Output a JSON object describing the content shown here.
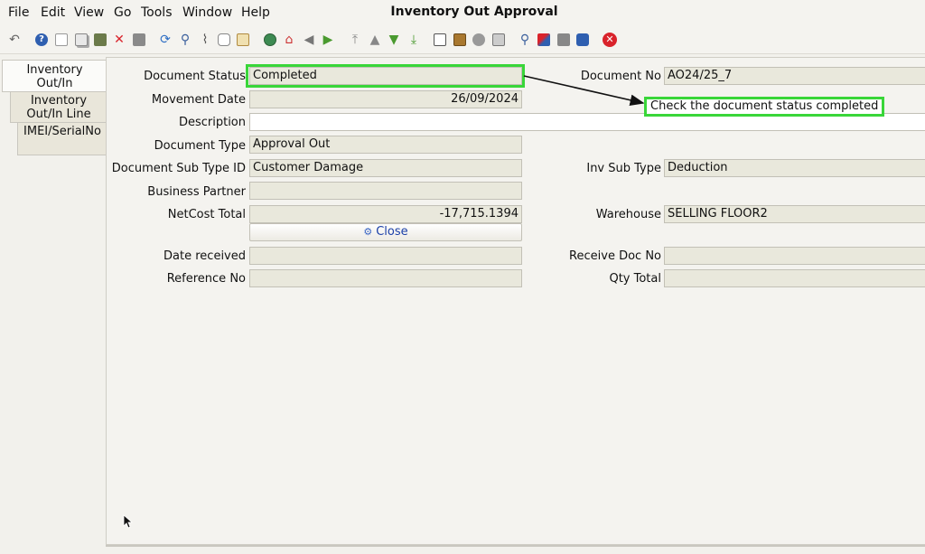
{
  "menu": {
    "items": [
      "File",
      "Edit",
      "View",
      "Go",
      "Tools",
      "Window",
      "Help"
    ]
  },
  "window": {
    "title": "Inventory Out Approval"
  },
  "toolbar": {
    "icons": [
      "undo-icon",
      "help-icon",
      "new-icon",
      "copy-icon",
      "save-icon",
      "delete-icon",
      "print-preview-icon",
      "refresh-icon",
      "find-icon",
      "attachment-icon",
      "chat-icon",
      "grid-toggle-icon",
      "history-icon",
      "home-icon",
      "back-icon",
      "forward-icon",
      "first-record-icon",
      "previous-record-icon",
      "next-record-icon",
      "last-record-icon",
      "report-icon",
      "archive-icon",
      "print-setup-icon",
      "print-icon",
      "zoom-across-icon",
      "workflow-icon",
      "product-info-icon",
      "lock-icon",
      "close-window-icon"
    ]
  },
  "tabs": [
    {
      "label": "Inventory Out/In",
      "active": true
    },
    {
      "label": "Inventory Out/In Line",
      "active": false
    },
    {
      "label": "IMEI/SerialNo",
      "active": false
    }
  ],
  "form": {
    "document_status": {
      "label": "Document Status",
      "value": "Completed"
    },
    "document_no": {
      "label": "Document No",
      "value": "AO24/25_7"
    },
    "movement_date": {
      "label": "Movement Date",
      "value": "26/09/2024"
    },
    "description": {
      "label": "Description",
      "value": ""
    },
    "document_type": {
      "label": "Document Type",
      "value": "Approval Out"
    },
    "document_sub_type_id": {
      "label": "Document Sub Type ID",
      "value": "Customer Damage"
    },
    "inv_sub_type": {
      "label": "Inv Sub Type",
      "value": "Deduction"
    },
    "business_partner": {
      "label": "Business Partner",
      "value": ""
    },
    "netcost_total": {
      "label": "NetCost Total",
      "value": "-17,715.1394"
    },
    "warehouse": {
      "label": "Warehouse",
      "value": "SELLING FLOOR2"
    },
    "close_button": {
      "label": "Close"
    },
    "date_received": {
      "label": "Date received",
      "value": ""
    },
    "receive_doc_no": {
      "label": "Receive Doc No",
      "value": ""
    },
    "reference_no": {
      "label": "Reference No",
      "value": ""
    },
    "qty_total": {
      "label": "Qty Total",
      "value": ""
    }
  },
  "annotation": {
    "callout_text": "Check the document status completed",
    "color": "#39d639"
  },
  "colors": {
    "field_bg": "#e9e8dc",
    "link_blue": "#1a3fa8",
    "delete_red": "#d9232b"
  }
}
